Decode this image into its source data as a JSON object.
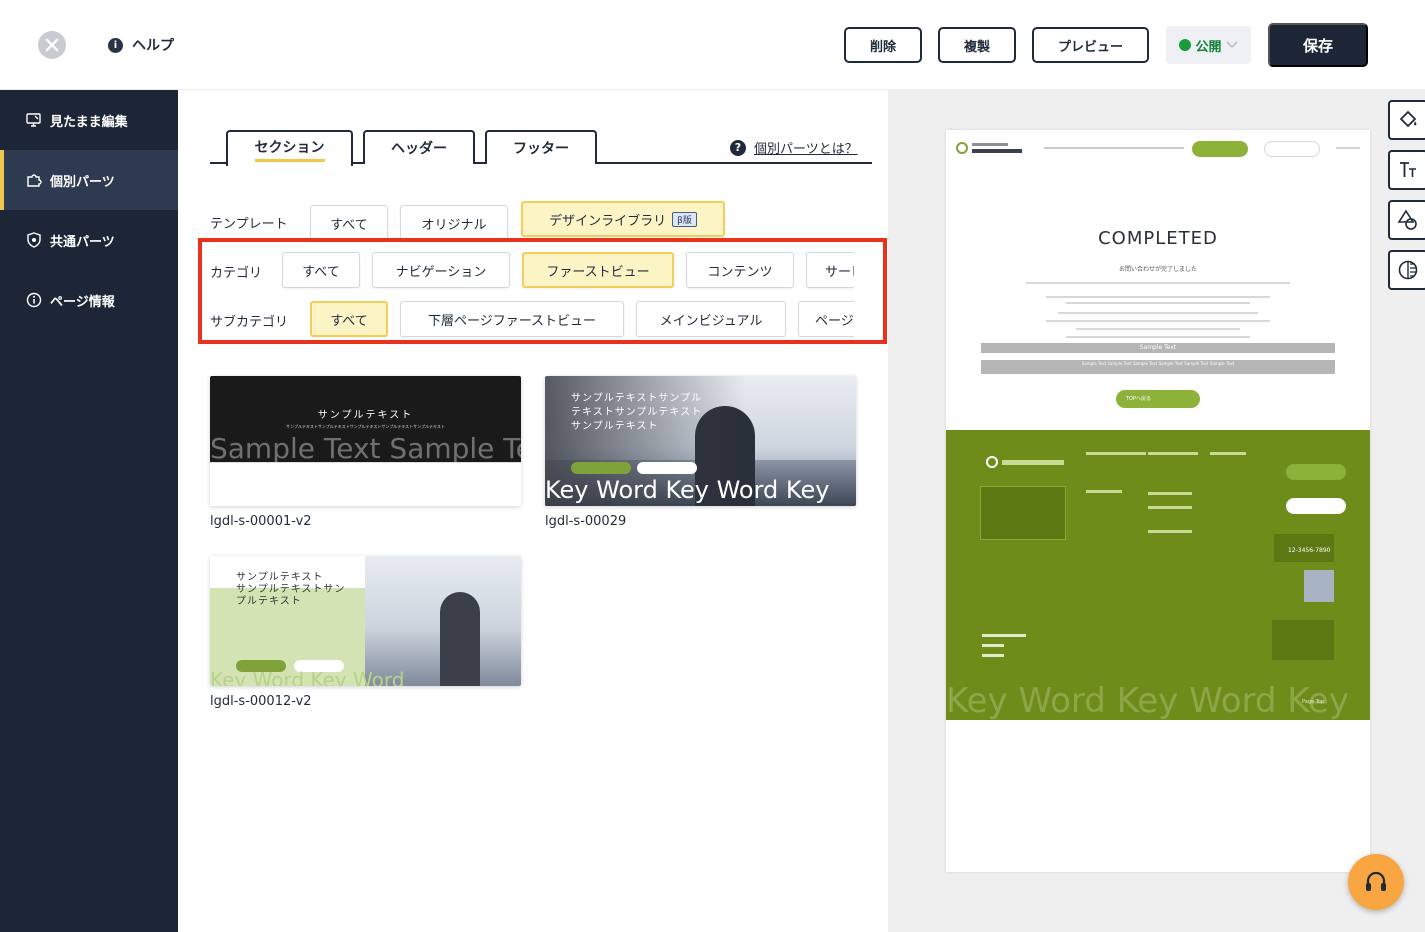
{
  "topbar": {
    "help_label": "ヘルプ",
    "delete_label": "削除",
    "duplicate_label": "複製",
    "preview_label": "プレビュー",
    "publish_status": "公開",
    "save_label": "保存"
  },
  "sidebar": {
    "items": [
      {
        "label": "見たまま編集",
        "icon": "monitor-edit-icon"
      },
      {
        "label": "個別パーツ",
        "icon": "puzzle-icon"
      },
      {
        "label": "共通パーツ",
        "icon": "shield-icon"
      },
      {
        "label": "ページ情報",
        "icon": "info-icon"
      }
    ]
  },
  "tabs": [
    {
      "label": "セクション"
    },
    {
      "label": "ヘッダー"
    },
    {
      "label": "フッター"
    }
  ],
  "what_parts_label": "個別パーツとは？",
  "filters": {
    "template": {
      "label": "テンプレート",
      "options": [
        "すべて",
        "オリジナル",
        "デザインライブラリ"
      ],
      "beta_badge": "β版"
    },
    "category": {
      "label": "カテゴリ",
      "options": [
        "すべて",
        "ナビゲーション",
        "ファーストビュー",
        "コンテンツ",
        "サービス"
      ]
    },
    "subcategory": {
      "label": "サブカテゴリ",
      "options": [
        "すべて",
        "下層ページファーストビュー",
        "メインビジュアル",
        "ページ"
      ]
    }
  },
  "cards": [
    {
      "name": "lgdl-s-00001-v2",
      "thumb_title": "サンプルテキスト",
      "thumb_sub": "サンプルテキストサンプルテキストサンプルテキストサンプルテキストサンプルテキスト",
      "thumb_big": "Sample Text Sample Text"
    },
    {
      "name": "lgdl-s-00029",
      "thumb_lines": [
        "サンプルテキストサンプル",
        "テキストサンプルテキスト",
        "サンプルテキスト"
      ],
      "thumb_big": "Key Word Key Word Key"
    },
    {
      "name": "lgdl-s-00012-v2",
      "thumb_lines": [
        "サンプルテキスト",
        "サンプルテキストサン",
        "プルテキスト"
      ],
      "thumb_big": "Key Word Key Word"
    }
  ],
  "preview": {
    "completed_title": "COMPLETED",
    "completed_sub": "お問い合わせが完了しました",
    "sample_text": "Sample Text",
    "sample_long": "Sample Text Sample Text Sample Text Sample Text Sample Text Sample Text",
    "top_button": "TOPへ戻る",
    "phone": "12-3456-7890",
    "footer_big": "Key Word Key Word Key",
    "page_top": "Page Top"
  },
  "colors": {
    "navy": "#1c2636",
    "accent_yellow": "#f2c84b",
    "highlight_red": "#e8321d",
    "green": "#6e8c1a",
    "publish_green": "#1c9b3e",
    "chat_orange": "#f7a642"
  }
}
